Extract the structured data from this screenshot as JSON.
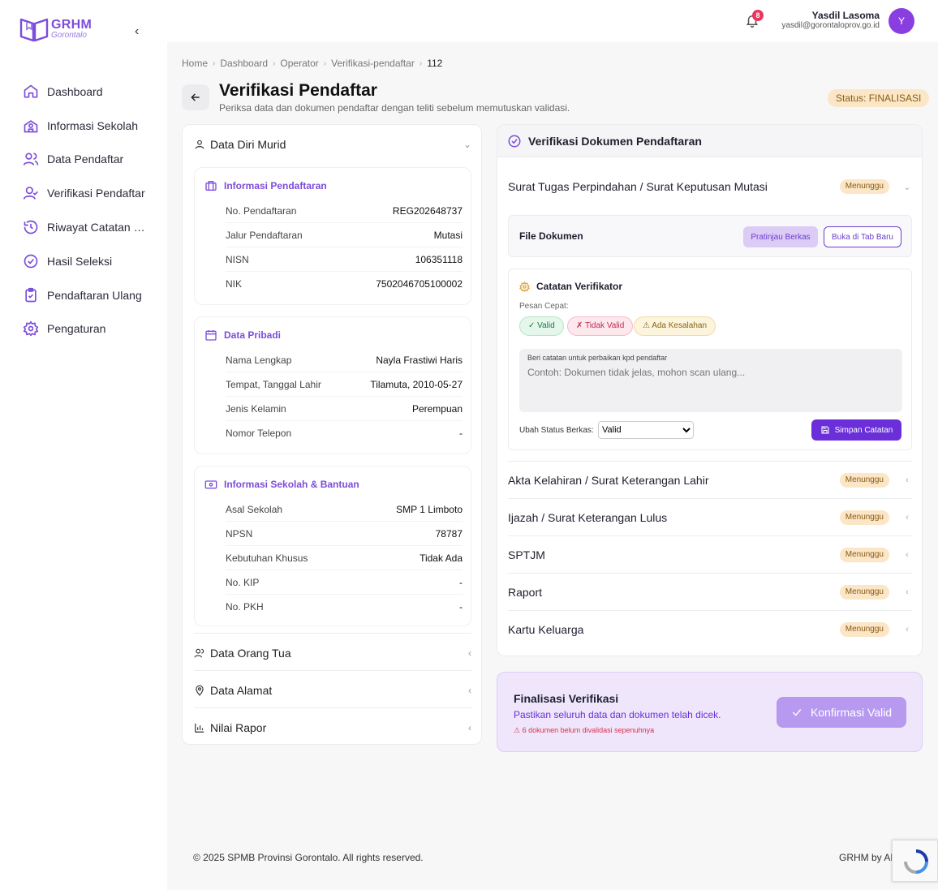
{
  "brand": {
    "name": "GRHM",
    "region": "Gorontalo",
    "accent": "#7c4ddb"
  },
  "sidebar": {
    "collapse_icon": "chevron-left-icon",
    "items": [
      {
        "label": "Dashboard",
        "icon": "home-icon"
      },
      {
        "label": "Informasi Sekolah",
        "icon": "school-icon"
      },
      {
        "label": "Data Pendaftar",
        "icon": "users-icon"
      },
      {
        "label": "Verifikasi Pendaftar",
        "icon": "user-check-icon"
      },
      {
        "label": "Riwayat Catatan Dokumen",
        "icon": "history-icon"
      },
      {
        "label": "Hasil Seleksi",
        "icon": "check-circle-icon"
      },
      {
        "label": "Pendaftaran Ulang",
        "icon": "clipboard-icon"
      },
      {
        "label": "Pengaturan",
        "icon": "gear-icon"
      }
    ]
  },
  "topbar": {
    "notif_count": "8",
    "user_name": "Yasdil Lasoma",
    "user_email": "yasdil@gorontaloprov.go.id",
    "avatar_initial": "Y"
  },
  "breadcrumb": [
    "Home",
    "Dashboard",
    "Operator",
    "Verifikasi-pendaftar",
    "112"
  ],
  "header": {
    "title": "Verifikasi Pendaftar",
    "subtitle": "Periksa data dan dokumen pendaftar dengan teliti sebelum memutuskan validasi.",
    "status": "Status: FINALISASI"
  },
  "left": {
    "section_title": "Data Diri Murid",
    "registration": {
      "title": "Informasi Pendaftaran",
      "rows": [
        {
          "k": "No. Pendaftaran",
          "v": "REG202648737"
        },
        {
          "k": "Jalur Pendaftaran",
          "v": "Mutasi"
        },
        {
          "k": "NISN",
          "v": "106351118"
        },
        {
          "k": "NIK",
          "v": "7502046705100002"
        }
      ]
    },
    "personal": {
      "title": "Data Pribadi",
      "rows": [
        {
          "k": "Nama Lengkap",
          "v": "Nayla Frastiwi Haris"
        },
        {
          "k": "Tempat, Tanggal Lahir",
          "v": "Tilamuta, 2010-05-27"
        },
        {
          "k": "Jenis Kelamin",
          "v": "Perempuan"
        },
        {
          "k": "Nomor Telepon",
          "v": "-"
        }
      ]
    },
    "school": {
      "title": "Informasi Sekolah & Bantuan",
      "rows": [
        {
          "k": "Asal Sekolah",
          "v": "SMP 1 Limboto"
        },
        {
          "k": "NPSN",
          "v": "78787"
        },
        {
          "k": "Kebutuhan Khusus",
          "v": "Tidak Ada"
        },
        {
          "k": "No. KIP",
          "v": "-"
        },
        {
          "k": "No. PKH",
          "v": "-"
        }
      ]
    },
    "collapsed": [
      {
        "label": "Data Orang Tua",
        "icon": "users-icon"
      },
      {
        "label": "Data Alamat",
        "icon": "map-pin-icon"
      },
      {
        "label": "Nilai Rapor",
        "icon": "bar-chart-icon"
      }
    ]
  },
  "right": {
    "title": "Verifikasi Dokumen Pendaftaran",
    "open_doc": {
      "name": "Surat Tugas Perpindahan / Surat Keputusan Mutasi",
      "status": "Menunggu"
    },
    "file": {
      "label": "File Dokumen",
      "preview_btn": "Pratinjau Berkas",
      "newtab_btn": "Buka di Tab Baru"
    },
    "notes": {
      "title": "Catatan Verifikator",
      "quick_label": "Pesan Cepat:",
      "chip_valid": "✓ Valid",
      "chip_invalid": "✗ Tidak Valid",
      "chip_error": "⚠ Ada Kesalahan",
      "textarea_label": "Beri catatan untuk perbaikan kpd pendaftar",
      "textarea_placeholder": "Contoh: Dokumen tidak jelas, mohon scan ulang...",
      "status_label": "Ubah Status Berkas:",
      "status_value": "Valid",
      "save_btn": "Simpan Catatan"
    },
    "docs": [
      {
        "name": "Akta Kelahiran / Surat Keterangan Lahir",
        "status": "Menunggu"
      },
      {
        "name": "Ijazah / Surat Keterangan Lulus",
        "status": "Menunggu"
      },
      {
        "name": "SPTJM",
        "status": "Menunggu"
      },
      {
        "name": "Raport",
        "status": "Menunggu"
      },
      {
        "name": "Kartu Keluarga",
        "status": "Menunggu"
      }
    ]
  },
  "final": {
    "title": "Finalisasi Verifikasi",
    "subtitle": "Pastikan seluruh data dan dokumen telah dicek.",
    "warning": "⚠ 6 dokumen belum divalidasi sepenuhnya",
    "confirm_btn": "Konfirmasi Valid"
  },
  "footer": {
    "copyright": "© 2025 SPMB Provinsi Gorontalo. All rights reserved.",
    "credit": "GRHM by AP"
  }
}
